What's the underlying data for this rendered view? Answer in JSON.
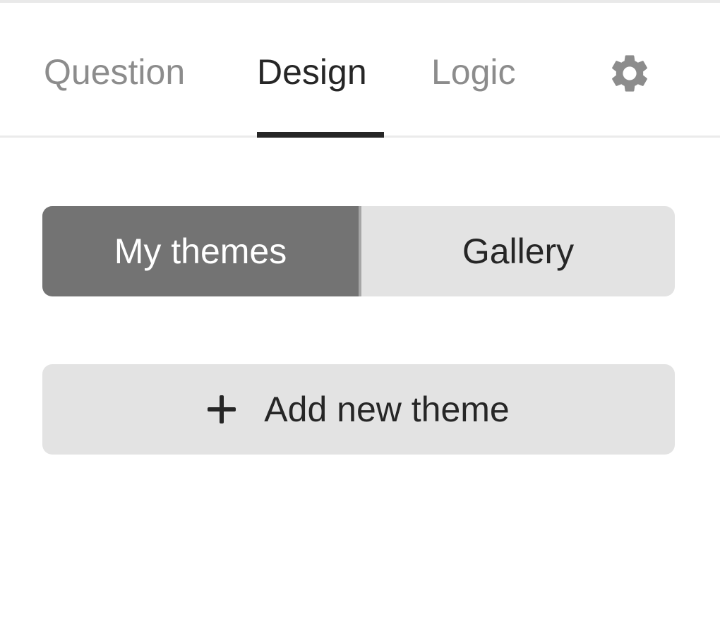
{
  "tabs": {
    "question": "Question",
    "design": "Design",
    "logic": "Logic",
    "active": "Design",
    "settings_icon": "gear-icon"
  },
  "themes": {
    "my_themes": "My themes",
    "gallery": "Gallery",
    "selected": "My themes"
  },
  "actions": {
    "add_new_theme": "Add new theme",
    "add_icon": "plus-icon"
  },
  "colors": {
    "active_tab_text": "#262626",
    "inactive_tab_text": "#8c8c8c",
    "selected_segment_bg": "#737373",
    "button_bg": "#e3e3e3",
    "settings_icon": "#8c8c8c"
  }
}
